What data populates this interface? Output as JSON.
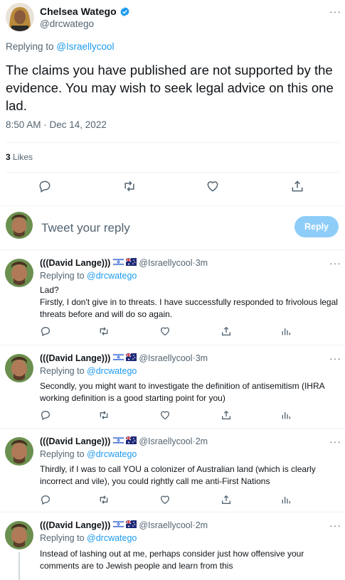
{
  "main_tweet": {
    "name": "Chelsea Watego",
    "handle": "@drcwatego",
    "replying_prefix": "Replying to ",
    "replying_handle": "@Israellycool",
    "text": "The claims you have published are not supported by the evidence. You may wish to seek legal advice on this one lad.",
    "timestamp": "8:50 AM · Dec 14, 2022",
    "likes_count": "3",
    "likes_label": " Likes",
    "more": "···"
  },
  "composer": {
    "placeholder": "Tweet your reply",
    "reply_label": "Reply"
  },
  "replies": [
    {
      "name": "(((David Lange)))",
      "handle": "@Israellycool",
      "time": "3m",
      "replying_prefix": "Replying to ",
      "replying_handle": "@drcwatego",
      "line1": "Lad?",
      "line2": "Firstly, I don't give in to threats. I have successfully responded to frivolous legal threats before and will do so again."
    },
    {
      "name": "(((David Lange)))",
      "handle": "@Israellycool",
      "time": "3m",
      "replying_prefix": "Replying to ",
      "replying_handle": "@drcwatego",
      "line1": "Secondly, you might want to investigate the definition of antisemitism (IHRA working definition is a good starting point for you)"
    },
    {
      "name": "(((David Lange)))",
      "handle": "@Israellycool",
      "time": "2m",
      "replying_prefix": "Replying to ",
      "replying_handle": "@drcwatego",
      "line1": "Thirdly, if I was to call YOU a colonizer of Australian land (which is clearly incorrect and vile), you could rightly call me anti-First Nations"
    },
    {
      "name": "(((David Lange)))",
      "handle": "@Israellycool",
      "time": "2m",
      "replying_prefix": "Replying to ",
      "replying_handle": "@drcwatego",
      "line1": "Instead of lashing out at me, perhaps consider just how offensive your comments are to Jewish people and learn from this"
    }
  ],
  "separator": " · ",
  "colors": {
    "accent": "#1d9bf0",
    "muted": "#536471",
    "reply_button": "#8ecdf8"
  }
}
